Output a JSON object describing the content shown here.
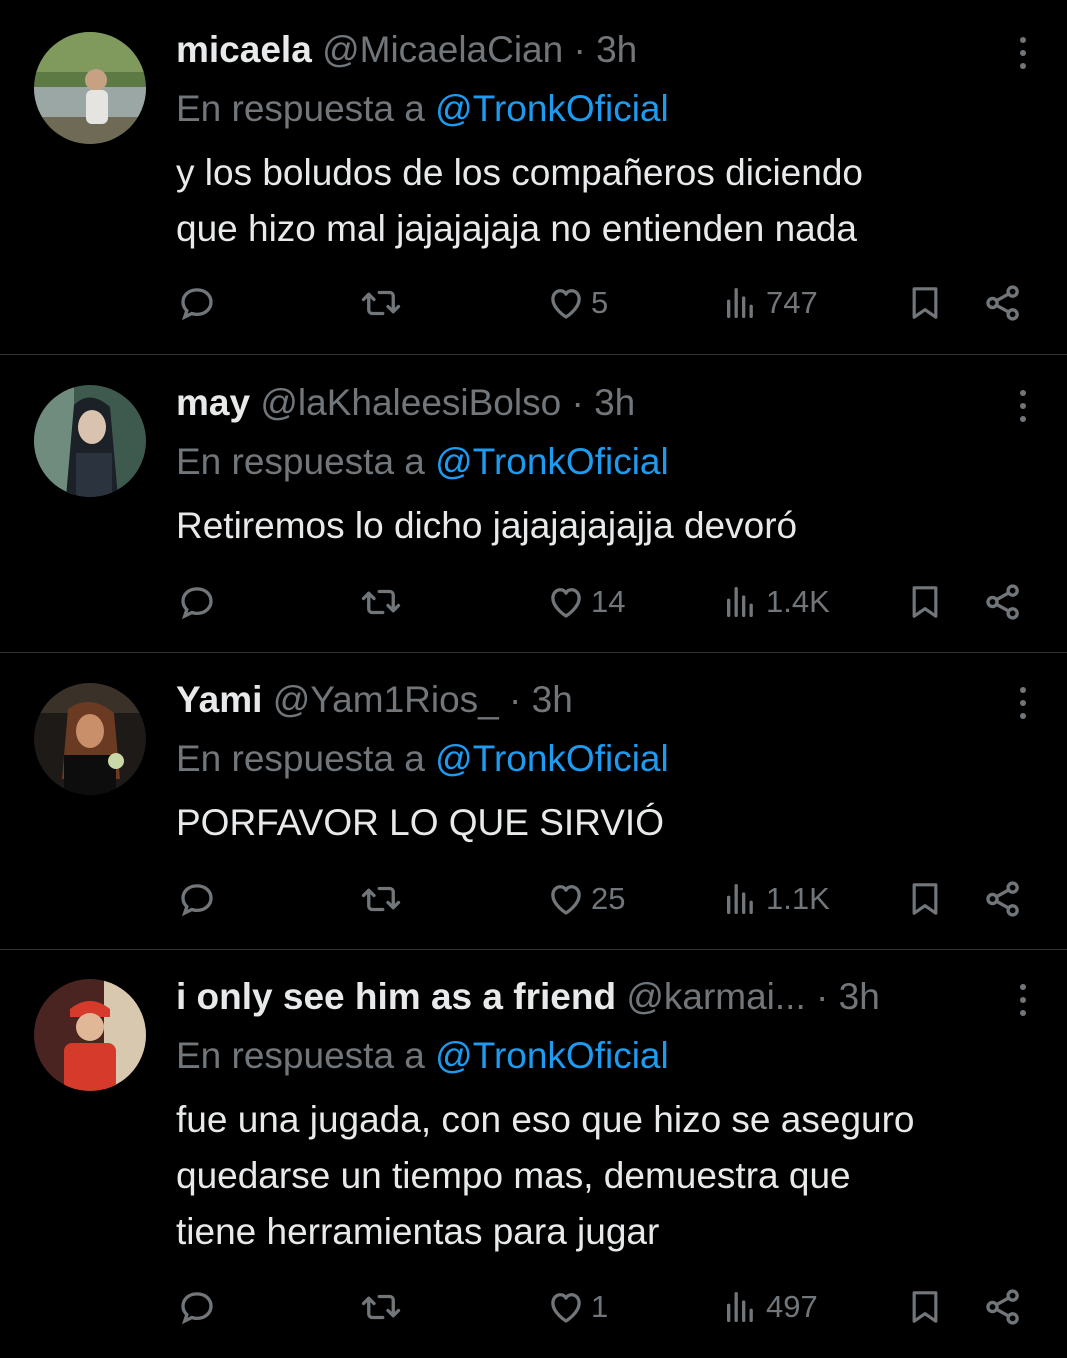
{
  "reply_prefix": "En respuesta a",
  "tweets": [
    {
      "name": "micaela",
      "handle": "@MicaelaCian",
      "time": "· 3h",
      "reply_to": "@TronkOficial",
      "lines": [
        "y los boludos de los compañeros diciendo",
        "que hizo mal jajajajaja no entienden nada"
      ],
      "likes": "5",
      "views": "747",
      "avatar_colors": [
        "#6f8a4a",
        "#b8b09a",
        "#3b4d3a"
      ]
    },
    {
      "name": "may",
      "handle": "@laKhaleesiBolso",
      "time": "· 3h",
      "reply_to": "@TronkOficial",
      "lines": [
        "Retiremos lo dicho jajajajajajja devoró"
      ],
      "likes": "14",
      "views": "1.4K",
      "avatar_colors": [
        "#3e5a4e",
        "#d9c2b0",
        "#1a2228"
      ]
    },
    {
      "name": "Yami",
      "handle": "@Yam1Rios_",
      "time": "· 3h",
      "reply_to": "@TronkOficial",
      "lines": [
        "PORFAVOR LO QUE SIRVIÓ"
      ],
      "likes": "25",
      "views": "1.1K",
      "avatar_colors": [
        "#2a2420",
        "#c98e6a",
        "#111111"
      ]
    },
    {
      "name": "i only see him as a friend",
      "handle": "@karmai...",
      "time": "· 3h",
      "reply_to": "@TronkOficial",
      "lines": [
        "fue una jugada, con eso que hizo se aseguro",
        "quedarse un tiempo mas, demuestra que",
        "tiene herramientas para jugar"
      ],
      "likes": "1",
      "views": "497",
      "avatar_colors": [
        "#8a2a22",
        "#d63a2a",
        "#e8d7c4"
      ]
    }
  ]
}
